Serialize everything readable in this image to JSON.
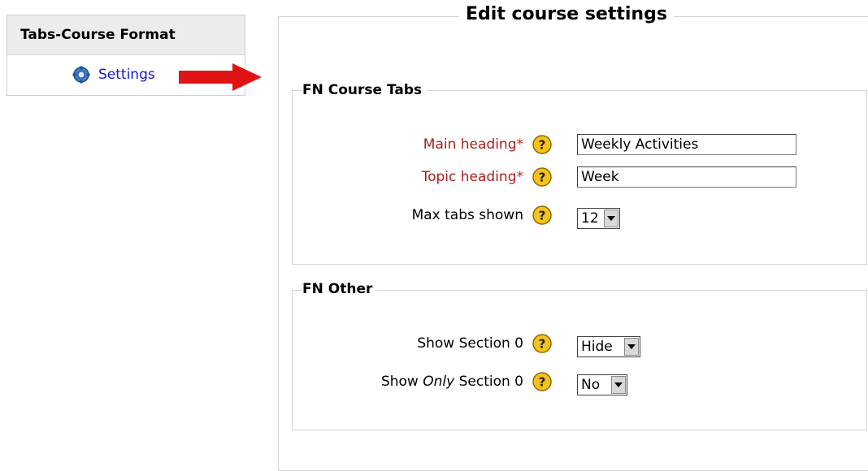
{
  "block": {
    "title": "Tabs-Course Format",
    "settings_label": "Settings"
  },
  "form": {
    "title": "Edit course settings",
    "fn_course_tabs": {
      "legend": "FN Course Tabs",
      "main_heading": {
        "label": "Main heading",
        "required_mark": "*",
        "value": "Weekly Activities"
      },
      "topic_heading": {
        "label": "Topic heading",
        "required_mark": "*",
        "value": "Week"
      },
      "max_tabs": {
        "label": "Max tabs shown",
        "value": "12"
      }
    },
    "fn_other": {
      "legend": "FN Other",
      "show_section0": {
        "label": "Show Section 0",
        "value": "Hide"
      },
      "show_only_section0": {
        "label_prefix": "Show ",
        "label_em": "Only",
        "label_suffix": " Section 0",
        "value": "No"
      }
    }
  },
  "colors": {
    "link": "#1414d6",
    "required_label": "#aa1f1f",
    "arrow": "#e01414",
    "help_icon": "#f4c21a"
  },
  "icons": [
    "gear-icon",
    "red-arrow-icon",
    "help-icon",
    "dropdown-arrow-icon"
  ]
}
